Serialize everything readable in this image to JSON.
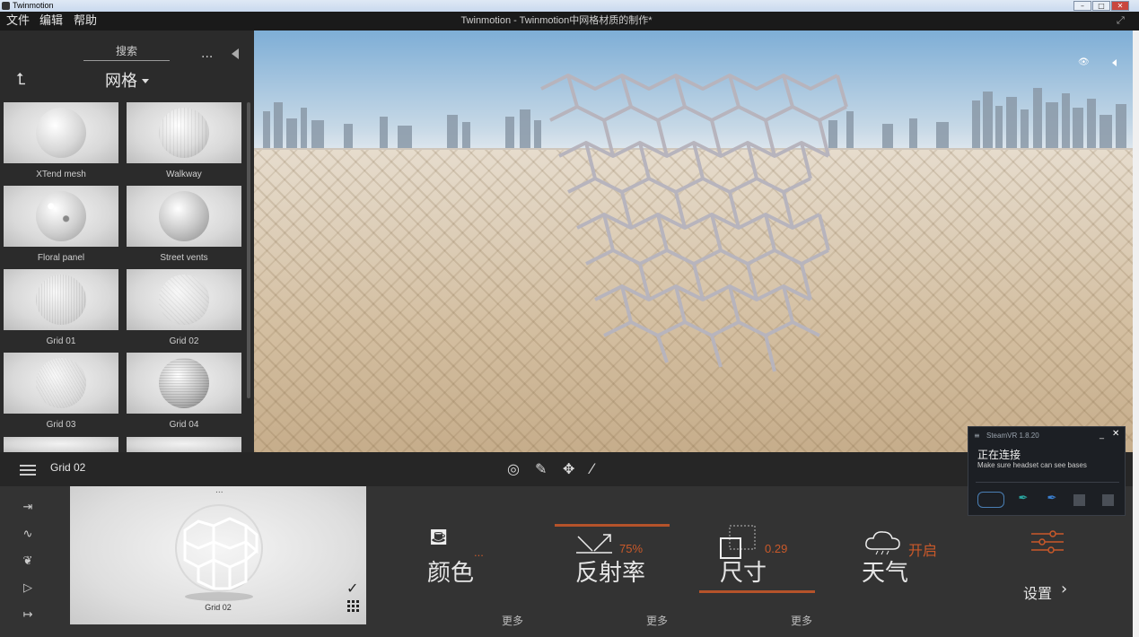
{
  "os": {
    "title": "Twinmotion",
    "min": "–",
    "max": "□",
    "close": "✕"
  },
  "menu": {
    "file": "文件",
    "edit": "编辑",
    "help": "帮助"
  },
  "document_title": "Twinmotion - Twinmotion中网格材质的制作*",
  "library": {
    "search_label": "搜索",
    "more": "...",
    "back": "⮤",
    "category": "网格",
    "items": [
      {
        "label": "XTend mesh"
      },
      {
        "label": "Walkway"
      },
      {
        "label": "Floral panel"
      },
      {
        "label": "Street vents"
      },
      {
        "label": "Grid 01"
      },
      {
        "label": "Grid 02"
      },
      {
        "label": "Grid 03"
      },
      {
        "label": "Grid 04"
      }
    ]
  },
  "toolbar": {
    "selected_name": "Grid 02"
  },
  "preview": {
    "label": "Grid 02",
    "dots": "...",
    "check": "✓"
  },
  "properties": {
    "color": {
      "label": "颜色",
      "value": "...",
      "more": "更多"
    },
    "reflectivity": {
      "label": "反射率",
      "value": "75%",
      "more": "更多"
    },
    "size": {
      "label": "尺寸",
      "value": "0.29",
      "more": "更多"
    },
    "weather": {
      "label": "天气",
      "value": "开启"
    },
    "settings": {
      "label": "设置",
      "chevron": "›"
    }
  },
  "steamvr": {
    "title": "SteamVR 1.8.20",
    "menu": "≡",
    "minimize": "_",
    "close": "✕",
    "status": "正在连接",
    "hint": "Make sure headset can see bases"
  },
  "colors": {
    "accent": "#b5532a",
    "panel": "#333333",
    "menubar": "#1a1a1a"
  }
}
